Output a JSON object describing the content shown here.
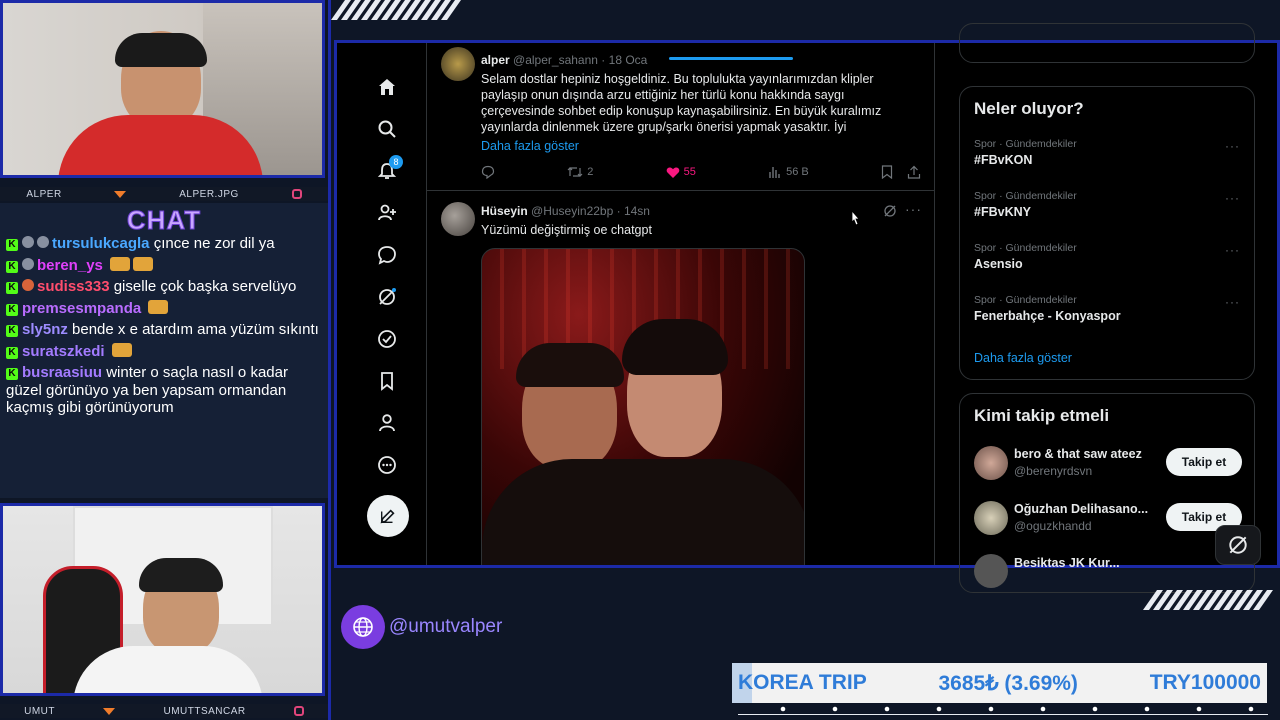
{
  "top_cam": {
    "left_label": "ALPER",
    "right_label": "ALPER.JPG"
  },
  "bottom_cam": {
    "left_label": "UMUT",
    "right_label": "UMUTTSANCAR"
  },
  "chat": {
    "title": "CHAT",
    "messages": [
      {
        "user": "tursulukcagla",
        "text": "çınce ne zor dil ya",
        "color": "#4aa8ff"
      },
      {
        "user": "beren_ys",
        "text": "",
        "color": "#e040fb"
      },
      {
        "user": "sudiss333",
        "text": "giselle çok başka servelüyo",
        "color": "#ff4d6d"
      },
      {
        "user": "premsesmpanda",
        "text": "",
        "color": "#b96cff"
      },
      {
        "user": "sly5nz",
        "text": "bende x e atardım ama yüzüm sıkıntı",
        "color": "#9d8cff"
      },
      {
        "user": "suratszkedi",
        "text": "",
        "color": "#a37bff"
      },
      {
        "user": "busraasiuu",
        "text": "winter o saçla nasıl o kadar güzel görünüyo ya ben yapsam ormandan kaçmış gibi görünüyorum",
        "color": "#a37bff"
      }
    ]
  },
  "twitter": {
    "nav": [
      "home-icon",
      "search-icon",
      "bell-icon",
      "people-icon",
      "message-icon",
      "grok-icon",
      "verified-icon",
      "bookmark-icon",
      "profile-icon",
      "more-icon",
      "compose-icon"
    ],
    "notification_count": "8",
    "tweet1": {
      "name": "alper",
      "handle": "@alper_sahann",
      "date": "18 Oca",
      "text": "Selam dostlar hepiniz hoşgeldiniz. Bu toplulukta yayınlarımızdan klipler paylaşıp onun dışında arzu ettiğiniz her türlü konu hakkında saygı çerçevesinde sohbet edip konuşup kaynaşabilirsiniz. En büyük kuralımız yayınlarda dinlenmek üzere grup/şarkı önerisi yapmak yasaktır. İyi",
      "more": "Daha fazla göster",
      "retweets": "2",
      "likes": "55",
      "views": "56 B"
    },
    "tweet2": {
      "name": "Hüseyin",
      "handle": "@Huseyin22bp",
      "time": "14sn",
      "text": "Yüzümü değiştirmiş oe chatgpt"
    },
    "trends": {
      "title": "Neler oluyor?",
      "items": [
        {
          "category": "Spor · Gündemdekiler",
          "name": "#FBvKON"
        },
        {
          "category": "Spor · Gündemdekiler",
          "name": "#FBvKNY"
        },
        {
          "category": "Spor · Gündemdekiler",
          "name": "Asensio"
        },
        {
          "category": "Spor · Gündemdekiler",
          "name": "Fenerbahçe - Konyaspor"
        }
      ],
      "more": "Daha fazla göster"
    },
    "follow": {
      "title": "Kimi takip etmeli",
      "items": [
        {
          "name": "bero & that saw ateez",
          "handle": "@berenyrdsvn",
          "button": "Takip et"
        },
        {
          "name": "Oğuzhan Delihasano...",
          "handle": "@oguzkhandd",
          "button": "Takip et"
        },
        {
          "name": "Besiktas JK Kur...",
          "handle": "",
          "button": ""
        }
      ]
    }
  },
  "social_handle": "@umutvalper",
  "ticker": {
    "title": "KOREA TRIP",
    "progress": "3685₺ (3.69%)",
    "goal": "TRY100000",
    "progress_fraction": 0.0369
  }
}
